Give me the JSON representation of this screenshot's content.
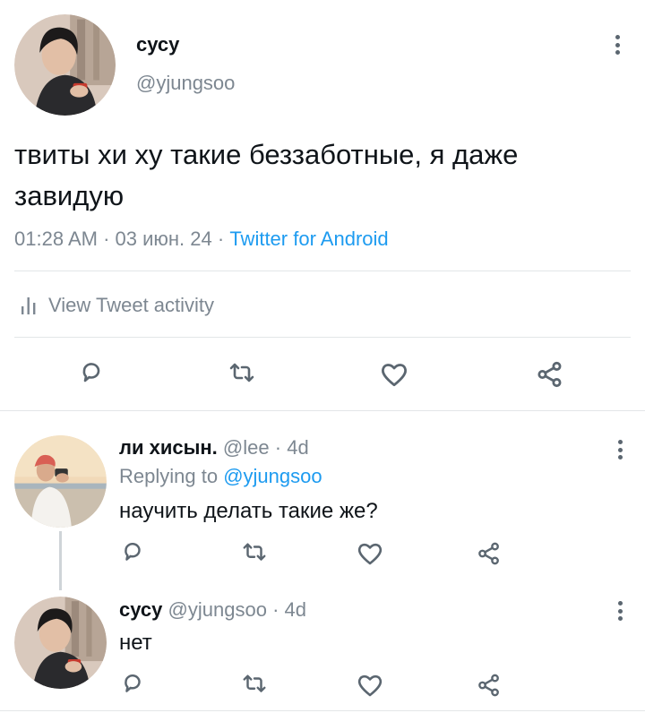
{
  "main_tweet": {
    "display_name": "сусу",
    "handle": "@yjungsoo",
    "text": "твиты хи ху такие беззаботные, я даже завидую",
    "time": "01:28 AM",
    "date": "03 июн. 24",
    "separator": "·",
    "client": "Twitter for Android",
    "activity_label": "View Tweet activity"
  },
  "replies": [
    {
      "display_name": "ли хисын.",
      "handle": "@lee",
      "time_ago": "4d",
      "separator": "·",
      "replying_prefix": "Replying to",
      "replying_to": "@yjungsoo",
      "text": "научить делать такие же?"
    },
    {
      "display_name": "сусу",
      "handle": "@yjungsoo",
      "time_ago": "4d",
      "separator": "·",
      "text": "нет"
    }
  ],
  "icons": {
    "reply": "reply-bubble-icon",
    "retweet": "retweet-icon",
    "like": "heart-icon",
    "share": "share-icon",
    "menu": "kebab-menu-icon",
    "activity": "bar-chart-icon"
  },
  "colors": {
    "link": "#1d9bf0",
    "muted": "#7d8791",
    "icon": "#5b6670",
    "divider": "#e3e6e8"
  }
}
